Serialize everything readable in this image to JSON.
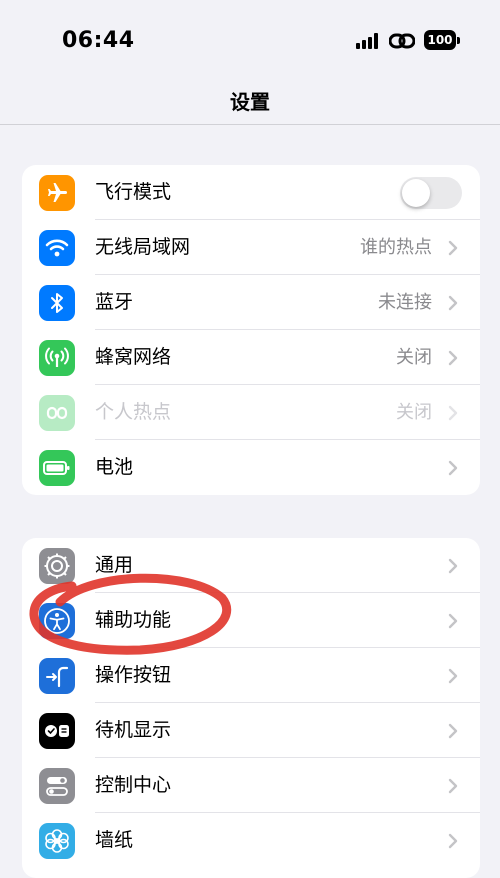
{
  "status_bar": {
    "time": "06:44",
    "battery": "100"
  },
  "nav": {
    "title": "设置"
  },
  "group1": [
    {
      "label": "飞行模式",
      "icon": "airplane-icon",
      "color": "#ff9500",
      "toggle": false
    },
    {
      "label": "无线局域网",
      "value": "谁的热点",
      "icon": "wifi-icon",
      "color": "#007aff"
    },
    {
      "label": "蓝牙",
      "value": "未连接",
      "icon": "bluetooth-icon",
      "color": "#007aff"
    },
    {
      "label": "蜂窝网络",
      "value": "关闭",
      "icon": "cellular-icon",
      "color": "#34c759"
    },
    {
      "label": "个人热点",
      "value": "关闭",
      "icon": "hotspot-icon",
      "color": "#34c759",
      "disabled": true
    },
    {
      "label": "电池",
      "icon": "battery-icon",
      "color": "#34c759"
    }
  ],
  "group2": [
    {
      "label": "通用",
      "icon": "gear-icon",
      "color": "#8e8e93"
    },
    {
      "label": "辅助功能",
      "icon": "accessibility-icon",
      "color": "#1e6fd9"
    },
    {
      "label": "操作按钮",
      "icon": "action-button-icon",
      "color": "#1e6fd9"
    },
    {
      "label": "待机显示",
      "icon": "standby-icon",
      "color": "#000000"
    },
    {
      "label": "控制中心",
      "icon": "control-center-icon",
      "color": "#8e8e93"
    },
    {
      "label": "墙纸",
      "icon": "wallpaper-icon",
      "color": "#32ade6"
    }
  ],
  "colors": {
    "annotation": "#e0342a"
  }
}
